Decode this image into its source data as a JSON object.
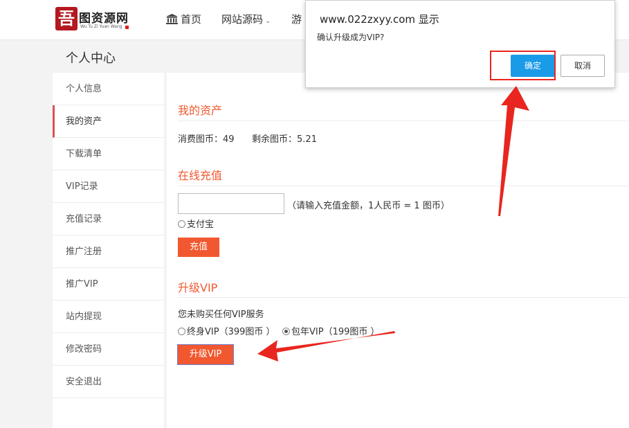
{
  "header": {
    "logo_text": "图资源网",
    "logo_char": "吾",
    "logo_sub": "Wu Tu Zi Yuan Wang",
    "nav": {
      "home": "首页",
      "source": "网站源码",
      "game": "游"
    }
  },
  "page_title": "个人中心",
  "sidebar": {
    "items": [
      {
        "label": "个人信息"
      },
      {
        "label": "我的资产"
      },
      {
        "label": "下载清单"
      },
      {
        "label": "VIP记录"
      },
      {
        "label": "充值记录"
      },
      {
        "label": "推广注册"
      },
      {
        "label": "推广VIP"
      },
      {
        "label": "站内提现"
      },
      {
        "label": "修改密码"
      },
      {
        "label": "安全退出"
      }
    ],
    "active_index": 1
  },
  "assets": {
    "title": "我的资产",
    "consumed_label": "消费图币：",
    "consumed_value": "49",
    "remaining_label": "剩余图币：",
    "remaining_value": "5.21"
  },
  "recharge": {
    "title": "在线充值",
    "input_value": "",
    "hint": "（请输入充值金额，1人民币 = 1 图币）",
    "payment_option": "支付宝",
    "button": "充值"
  },
  "vip": {
    "title": "升级VIP",
    "status": "您未购买任何VIP服务",
    "option_lifetime": "终身VIP（399图币 ）",
    "option_yearly": "包年VIP（199图币 ）",
    "selected": "yearly",
    "button": "升级VIP"
  },
  "dialog": {
    "title": "www.022zxyy.com 显示",
    "message": "确认升级成为VIP?",
    "ok": "确定",
    "cancel": "取消"
  },
  "colors": {
    "accent": "#f1582f",
    "ok_button": "#1a9be8",
    "annotation": "#e8261f",
    "active_bar": "#d9534f"
  }
}
